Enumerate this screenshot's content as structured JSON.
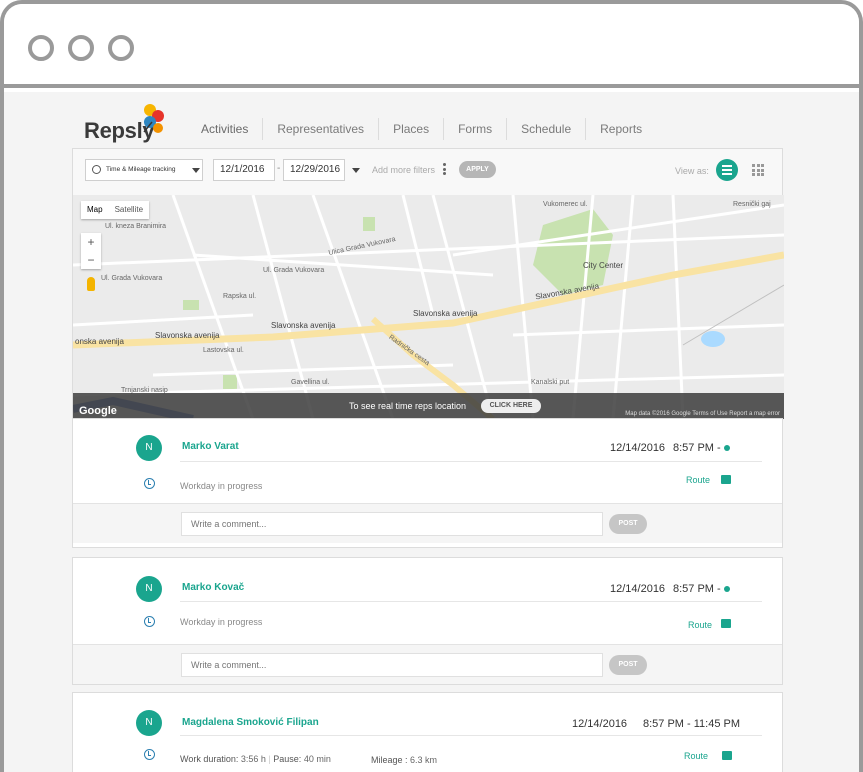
{
  "app": {
    "logo_text": "Repsly"
  },
  "nav": {
    "items": [
      "Activities",
      "Representatives",
      "Places",
      "Forms",
      "Schedule",
      "Reports"
    ],
    "active": "Activities"
  },
  "filters": {
    "activity_type": "Time & Mileage tracking",
    "date_from": "12/1/2016",
    "date_to": "12/29/2016",
    "date_separator": "-",
    "more_filters": "Add more filters",
    "apply_label": "APPLY",
    "view_as_label": "View as:"
  },
  "map": {
    "tabs": [
      "Map",
      "Satellite"
    ],
    "zoom_in": "+",
    "zoom_out": "−",
    "banner_text": "To see real time reps location",
    "banner_button": "CLICK HERE",
    "attribution": "Map data ©2016 Google   Terms of Use   Report a map error",
    "google": "Google",
    "labels": {
      "slavonska_left": "onska avenija",
      "slavonska_mid": "Slavonska avenija",
      "slavonska_mid2": "Slavonska avenija",
      "slavonska_right": "Slavonska avenija",
      "city_center": "City Center",
      "grada_vukovara_1": "Ul. Grada Vukovara",
      "grada_vukovara_2": "Ul. Grada Vukovara",
      "grada_vukovara_3": "Ulica Grada Vukovara",
      "radnicka": "Radnička cesta",
      "kneza": "Ul. kneza Branimira",
      "lastovska": "Lastovska ul.",
      "rapska": "Rapska ul.",
      "kanalski": "Kanalski put",
      "gavellina": "Gavellina ul.",
      "vukomerec": "Vukomerec ul.",
      "resnicki": "Resnički gaj",
      "trnjanski": "Trnjanski nasip"
    }
  },
  "activities": [
    {
      "initial": "N",
      "name": "Marko Varat",
      "date": "12/14/2016",
      "time": "8:57 PM -",
      "status": "Workday in progress",
      "route_label": "Route",
      "comment_placeholder": "Write a comment...",
      "post_label": "POST"
    },
    {
      "initial": "N",
      "name": "Marko Kovač",
      "date": "12/14/2016",
      "time": "8:57 PM -",
      "status": "Workday in progress",
      "route_label": "Route",
      "comment_placeholder": "Write a comment...",
      "post_label": "POST"
    },
    {
      "initial": "N",
      "name": "Magdalena Smoković Filipan",
      "date": "12/14/2016",
      "time": "8:57 PM - 11:45 PM",
      "work_duration_label": "Work duration:",
      "work_duration": "3:56 h",
      "pause_label": "Pause:",
      "pause": "40 min",
      "mileage_label": "Mileage :",
      "mileage": "6.3 km",
      "route_label": "Route"
    }
  ],
  "colors": {
    "accent": "#1aa58e",
    "clock": "#2b7fb0"
  }
}
